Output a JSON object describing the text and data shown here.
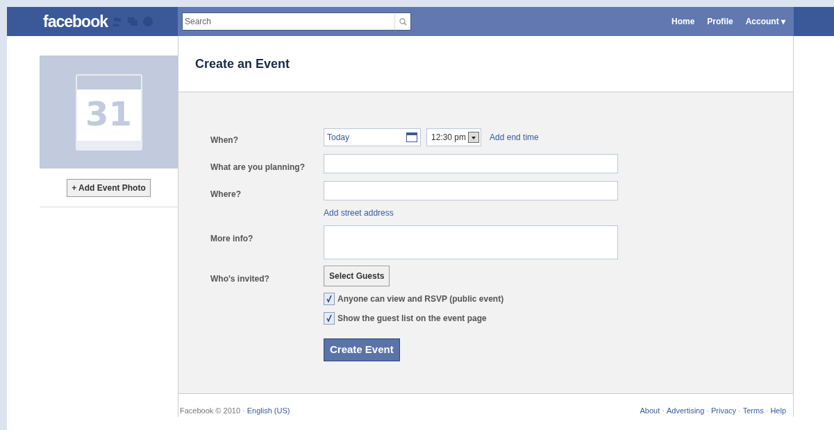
{
  "header": {
    "logo": "facebook",
    "search": {
      "placeholder": "Search"
    },
    "nav": [
      "Home",
      "Profile",
      "Account ▾"
    ]
  },
  "sidebar": {
    "calendar_day": "31",
    "add_photo_button": "+ Add Event Photo"
  },
  "page": {
    "title": "Create an Event"
  },
  "form": {
    "rows": [
      {
        "kind": "when",
        "label": "When?",
        "date": "Today",
        "time": "12:30 pm",
        "link": "Add end time"
      },
      {
        "kind": "text",
        "label": "What are you planning?"
      },
      {
        "kind": "text",
        "label": "Where?",
        "link": "Add street address"
      },
      {
        "kind": "textarea",
        "label": "More info?"
      },
      {
        "kind": "button",
        "label": "Who's invited?",
        "button": "Select Guests"
      }
    ],
    "options": [
      {
        "label": "Anyone can view and RSVP (public event)",
        "checked": true
      },
      {
        "label": "Show the guest list on the event page",
        "checked": true
      }
    ],
    "submit": "Create Event"
  },
  "footer": {
    "separator": "·",
    "left": [
      {
        "text": "Facebook © 2010",
        "link": false
      },
      {
        "text": "English (US)",
        "link": true
      }
    ],
    "right": [
      "About",
      "Advertising",
      "Privacy",
      "Terms",
      "Help"
    ]
  }
}
